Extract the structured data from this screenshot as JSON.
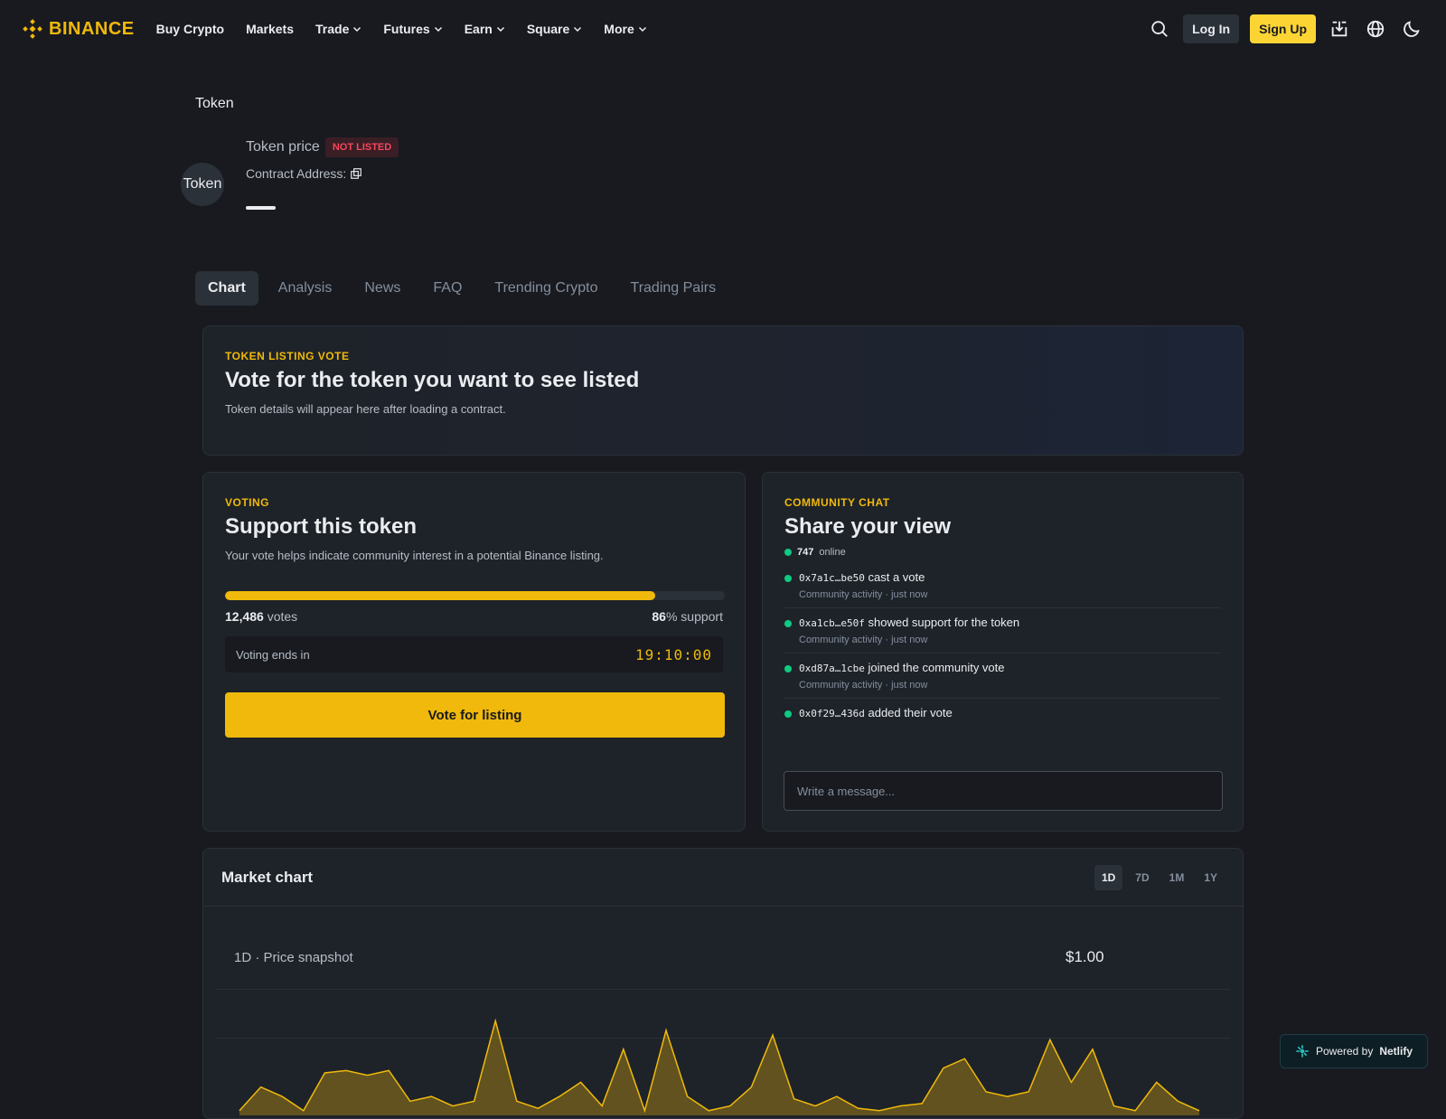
{
  "brand": {
    "name": "BINANCE",
    "color": "#f0b90b"
  },
  "nav": {
    "items": [
      {
        "label": "Buy Crypto",
        "has_menu": false
      },
      {
        "label": "Markets",
        "has_menu": false
      },
      {
        "label": "Trade",
        "has_menu": true
      },
      {
        "label": "Futures",
        "has_menu": true
      },
      {
        "label": "Earn",
        "has_menu": true
      },
      {
        "label": "Square",
        "has_menu": true
      },
      {
        "label": "More",
        "has_menu": true
      }
    ],
    "login_label": "Log In",
    "signup_label": "Sign Up",
    "icons": [
      "search-icon",
      "download-icon",
      "globe-icon",
      "moon-icon"
    ]
  },
  "breadcrumb": "Token",
  "token": {
    "avatar_alt": "Token",
    "title": "Token price",
    "status_badge": "NOT LISTED",
    "contract_label": "Contract Address:"
  },
  "tabs": [
    {
      "label": "Chart",
      "active": true
    },
    {
      "label": "Analysis",
      "active": false
    },
    {
      "label": "News",
      "active": false
    },
    {
      "label": "FAQ",
      "active": false
    },
    {
      "label": "Trending Crypto",
      "active": false
    },
    {
      "label": "Trading Pairs",
      "active": false
    }
  ],
  "listing_vote": {
    "eyebrow": "TOKEN LISTING VOTE",
    "heading": "Vote for the token you want to see listed",
    "description": "Token details will appear here after loading a contract."
  },
  "voting": {
    "eyebrow": "VOTING",
    "heading": "Support this token",
    "description": "Your vote helps indicate community interest in a potential Binance listing.",
    "progress_percent": 86,
    "vote_count": "12,486",
    "votes_word": "votes",
    "support_percent": "86",
    "support_suffix": "% support",
    "ends_label": "Voting ends in",
    "countdown": "19:10:00",
    "button_label": "Vote for listing"
  },
  "chat": {
    "eyebrow": "COMMUNITY CHAT",
    "heading": "Share your view",
    "online_count": "747",
    "online_word": "online",
    "messages": [
      {
        "address": "0x7a1c…be50",
        "text": "cast a vote",
        "meta": "Community activity · just now"
      },
      {
        "address": "0xa1cb…e50f",
        "text": "showed support for the token",
        "meta": "Community activity · just now"
      },
      {
        "address": "0xd87a…1cbe",
        "text": "joined the community vote",
        "meta": "Community activity · just now"
      },
      {
        "address": "0x0f29…436d",
        "text": "added their vote",
        "meta": ""
      }
    ],
    "input_placeholder": "Write a message..."
  },
  "market": {
    "title": "Market chart",
    "ranges": [
      {
        "label": "1D",
        "active": true
      },
      {
        "label": "7D",
        "active": false
      },
      {
        "label": "1M",
        "active": false
      },
      {
        "label": "1Y",
        "active": false
      }
    ],
    "snapshot_label": "1D · Price snapshot",
    "price": "$1.00"
  },
  "chart_data": {
    "type": "area",
    "title": "",
    "series_color": "#f0b90b",
    "values": [
      0.1,
      0.6,
      0.4,
      0.1,
      0.9,
      0.95,
      0.85,
      0.95,
      0.3,
      0.4,
      0.2,
      0.3,
      2.0,
      0.3,
      0.15,
      0.4,
      0.7,
      0.2,
      1.4,
      0.1,
      1.8,
      0.4,
      0.1,
      0.2,
      0.6,
      1.7,
      0.35,
      0.2,
      0.4,
      0.15,
      0.1,
      0.2,
      0.25,
      1.0,
      1.2,
      0.5,
      0.4,
      0.5,
      1.6,
      0.7,
      1.4,
      0.2,
      0.1,
      0.7,
      0.3,
      0.1
    ],
    "ylim": [
      0,
      2.2
    ],
    "grid": true
  },
  "footer_badge": {
    "prefix": "Powered by",
    "brand": "Netlify"
  }
}
